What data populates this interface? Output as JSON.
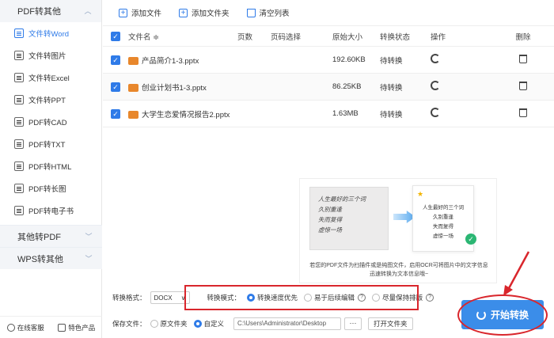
{
  "sidebar": {
    "group_top": "PDF转其他",
    "items": [
      {
        "label": "文件转Word",
        "active": true
      },
      {
        "label": "文件转图片"
      },
      {
        "label": "文件转Excel"
      },
      {
        "label": "文件转PPT"
      },
      {
        "label": "PDF转CAD"
      },
      {
        "label": "PDF转TXT"
      },
      {
        "label": "PDF转HTML"
      },
      {
        "label": "PDF转长图"
      },
      {
        "label": "PDF转电子书"
      }
    ],
    "group_2": "其他转PDF",
    "group_3": "WPS转其他",
    "footer_left": "在线客服",
    "footer_right": "特色产品"
  },
  "toolbar": {
    "add_file": "添加文件",
    "add_folder": "添加文件夹",
    "clear_list": "清空列表"
  },
  "table": {
    "headers": {
      "name": "文件名 ≑",
      "pages": "页数",
      "range": "页码选择",
      "size": "原始大小",
      "status": "转换状态",
      "op": "操作",
      "del": "删除"
    },
    "rows": [
      {
        "name": "产品简介1-3.pptx",
        "size": "192.60KB",
        "status": "待转换"
      },
      {
        "name": "创业计划书1-3.pptx",
        "size": "86.25KB",
        "status": "待转换"
      },
      {
        "name": "大学生恋爱情况报告2.pptx",
        "size": "1.63MB",
        "status": "待转换"
      }
    ]
  },
  "promo": {
    "handwriting": [
      "人生最好的三个词",
      "久别重逢",
      "失而复得",
      "虚惊一场"
    ],
    "card_lines": [
      "人生最好的三个词",
      "久别重逢",
      "失而复得",
      "虚惊一场"
    ],
    "caption": "若您的PDF文件为扫描件或是纯图文件，启用OCR可将图片中的文字信息迅速转换为文本信息哦~"
  },
  "settings": {
    "format_label": "转换格式：",
    "format_value": "DOCX",
    "mode_label": "转换模式：",
    "mode_options": [
      "转换速度优先",
      "易于后续编辑",
      "尽量保持排版"
    ],
    "save_label": "保存文件：",
    "save_options": [
      "原文件夹",
      "自定义"
    ],
    "path": "C:\\Users\\Administrator\\Desktop",
    "browse": "···",
    "open_folder": "打开文件夹"
  },
  "start_button": "开始转换",
  "colors": {
    "accent": "#3b8de9",
    "annotation": "#d9262c",
    "file_icon": "#e8872c"
  }
}
